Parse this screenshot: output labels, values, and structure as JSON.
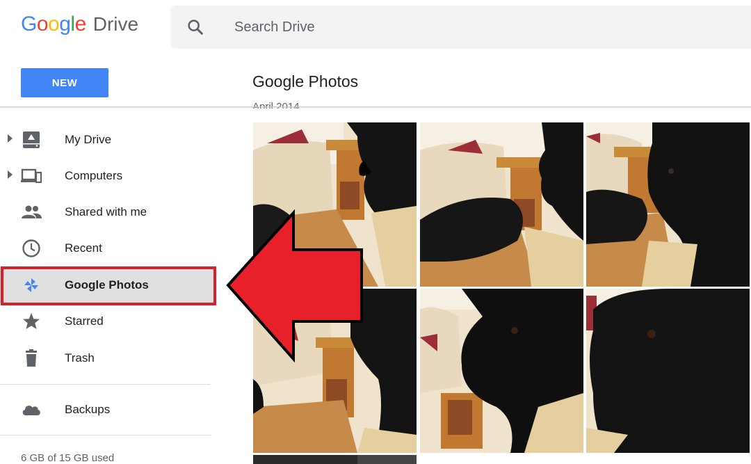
{
  "header": {
    "logo_google": "Google",
    "logo_drive": "Drive",
    "search_placeholder": "Search Drive"
  },
  "toolbar": {
    "new_label": "NEW",
    "page_title": "Google Photos",
    "section_date": "April 2014"
  },
  "sidebar": {
    "items": [
      {
        "label": "My Drive",
        "icon": "drive-icon",
        "expandable": true
      },
      {
        "label": "Computers",
        "icon": "computers-icon",
        "expandable": true
      },
      {
        "label": "Shared with me",
        "icon": "people-icon",
        "expandable": false
      },
      {
        "label": "Recent",
        "icon": "clock-icon",
        "expandable": false
      },
      {
        "label": "Google Photos",
        "icon": "pinwheel-icon",
        "expandable": false,
        "active": true
      },
      {
        "label": "Starred",
        "icon": "star-icon",
        "expandable": false
      },
      {
        "label": "Trash",
        "icon": "trash-icon",
        "expandable": false
      },
      {
        "label": "Backups",
        "icon": "cloud-icon",
        "expandable": false
      }
    ],
    "storage": "6 GB of 15 GB used"
  },
  "colors": {
    "brand_blue": "#4285f4",
    "annotation_red": "#e8202a",
    "highlight_red": "#d7202a"
  }
}
